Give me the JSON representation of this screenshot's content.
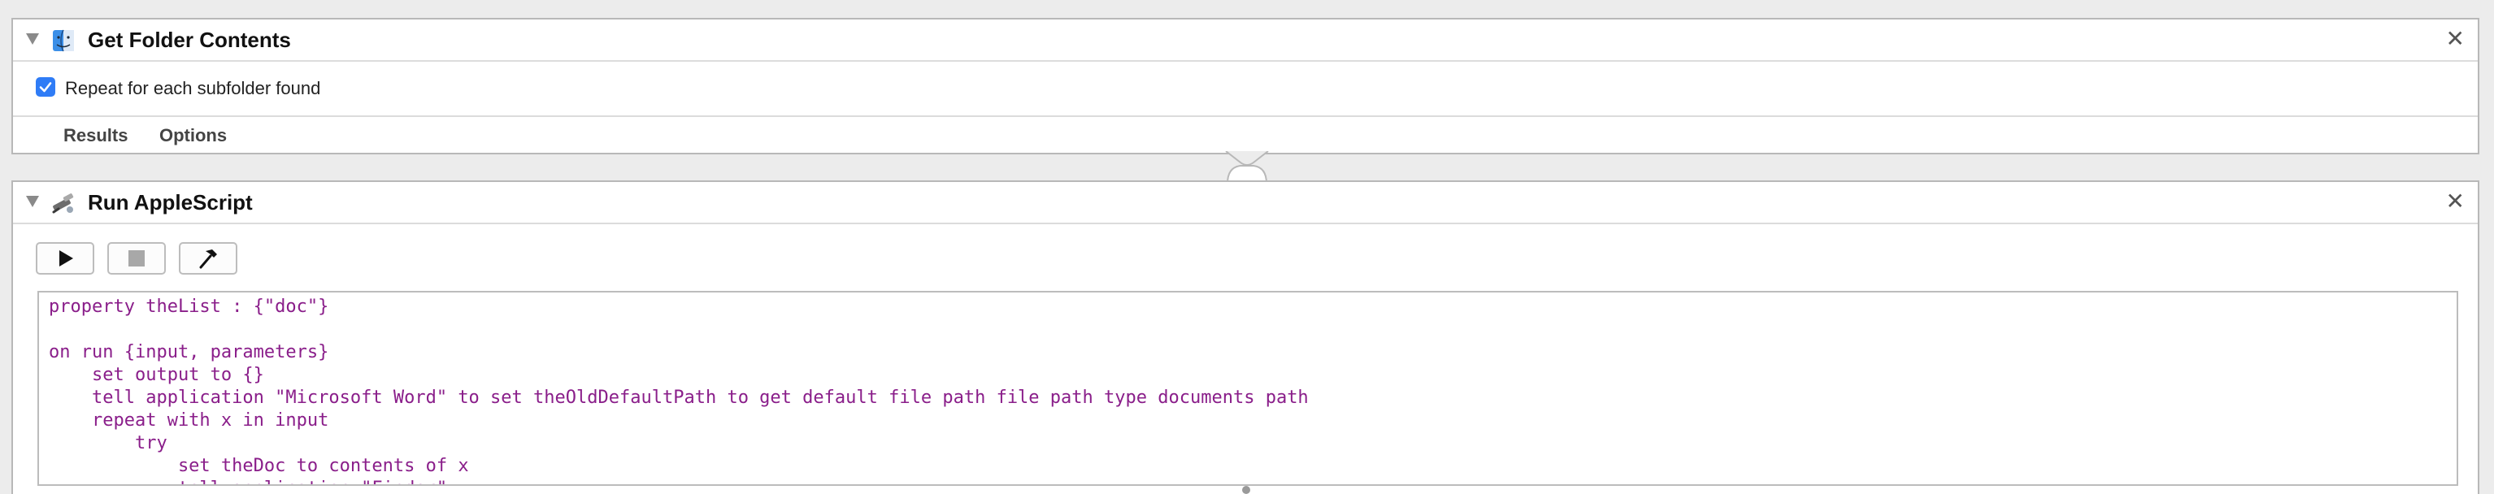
{
  "actions": [
    {
      "title": "Get Folder Contents",
      "close_symbol": "✕",
      "icon": "finder-folder-icon",
      "checkbox": {
        "label": "Repeat for each subfolder found",
        "checked": true
      },
      "tabs": [
        "Results",
        "Options"
      ]
    },
    {
      "title": "Run AppleScript",
      "close_symbol": "✕",
      "icon": "applescript-icon",
      "toolbar": [
        "run-icon",
        "stop-icon",
        "compile-hammer-icon"
      ],
      "code_lines": [
        "property theList : {\"doc\"}",
        "",
        "on run {input, parameters}",
        "    set output to {}",
        "    tell application \"Microsoft Word\" to set theOldDefaultPath to get default file path file path type documents path",
        "    repeat with x in input",
        "        try",
        "            set theDoc to contents of x",
        "            tell application \"Finder\""
      ]
    }
  ],
  "colors": {
    "code_text": "#8a1e8a",
    "checkbox_accent": "#2f7cf6"
  }
}
